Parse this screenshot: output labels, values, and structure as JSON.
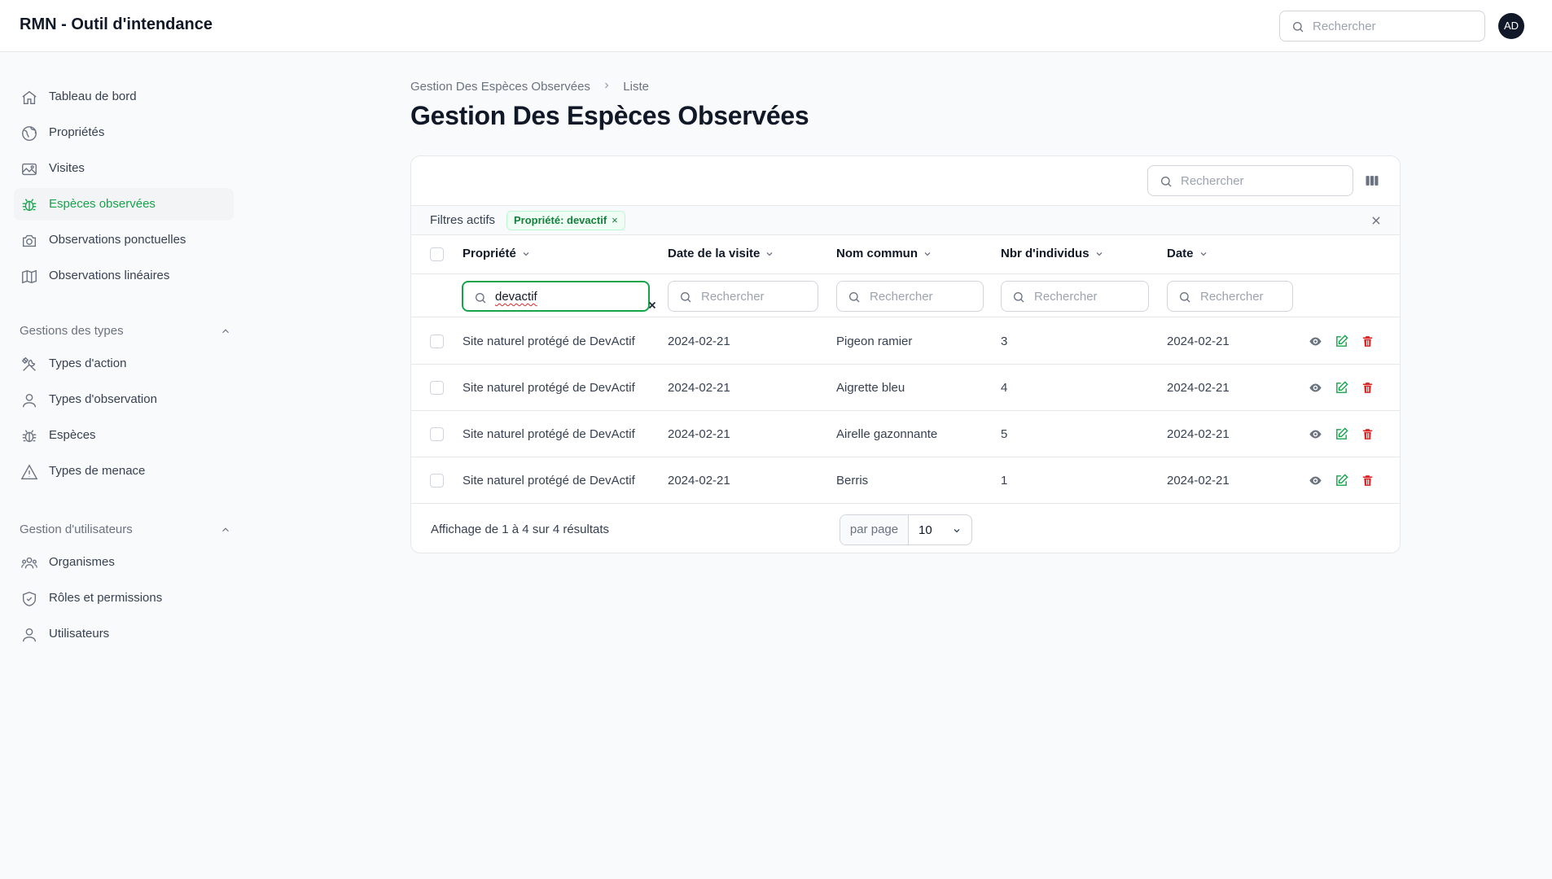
{
  "app": {
    "title": "RMN - Outil d'intendance"
  },
  "topbar": {
    "search_placeholder": "Rechercher",
    "avatar": "AD"
  },
  "sidebar": {
    "main_items": [
      {
        "label": "Tableau de bord",
        "icon": "home-icon"
      },
      {
        "label": "Propriétés",
        "icon": "globe-icon"
      },
      {
        "label": "Visites",
        "icon": "photo-icon"
      },
      {
        "label": "Espèces observées",
        "icon": "bug-icon",
        "active": true
      },
      {
        "label": "Observations ponctuelles",
        "icon": "camera-icon"
      },
      {
        "label": "Observations linéaires",
        "icon": "map-icon"
      }
    ],
    "groups": [
      {
        "label": "Gestions des types",
        "items": [
          {
            "label": "Types d'action",
            "icon": "tools-icon"
          },
          {
            "label": "Types d'observation",
            "icon": "user-icon"
          },
          {
            "label": "Espèces",
            "icon": "bug-icon"
          },
          {
            "label": "Types de menace",
            "icon": "warning-icon"
          }
        ]
      },
      {
        "label": "Gestion d'utilisateurs",
        "items": [
          {
            "label": "Organismes",
            "icon": "users-group-icon"
          },
          {
            "label": "Rôles et permissions",
            "icon": "shield-check-icon"
          },
          {
            "label": "Utilisateurs",
            "icon": "user-icon"
          }
        ]
      }
    ]
  },
  "breadcrumb": {
    "parent": "Gestion Des Espèces Observées",
    "current": "Liste"
  },
  "page": {
    "title": "Gestion Des Espèces Observées"
  },
  "table": {
    "search_placeholder": "Rechercher",
    "filters_label": "Filtres actifs",
    "active_filter": "Propriété: devactif",
    "columns": [
      "Propriété",
      "Date de la visite",
      "Nom commun",
      "Nbr d'individus",
      "Date"
    ],
    "column_filters": {
      "propriete_value": "devactif",
      "placeholder": "Rechercher"
    },
    "rows": [
      [
        "Site naturel protégé de DevActif",
        "2024-02-21",
        "Pigeon ramier",
        "3",
        "2024-02-21"
      ],
      [
        "Site naturel protégé de DevActif",
        "2024-02-21",
        "Aigrette bleu",
        "4",
        "2024-02-21"
      ],
      [
        "Site naturel protégé de DevActif",
        "2024-02-21",
        "Airelle gazonnante",
        "5",
        "2024-02-21"
      ],
      [
        "Site naturel protégé de DevActif",
        "2024-02-21",
        "Berris",
        "1",
        "2024-02-21"
      ]
    ],
    "footer": {
      "info": "Affichage de 1 à 4 sur 4 résultats",
      "per_page_label": "par page",
      "per_page_value": "10"
    }
  },
  "colors": {
    "accent": "#16a34a",
    "danger": "#dc2626",
    "muted": "#6b7280"
  }
}
